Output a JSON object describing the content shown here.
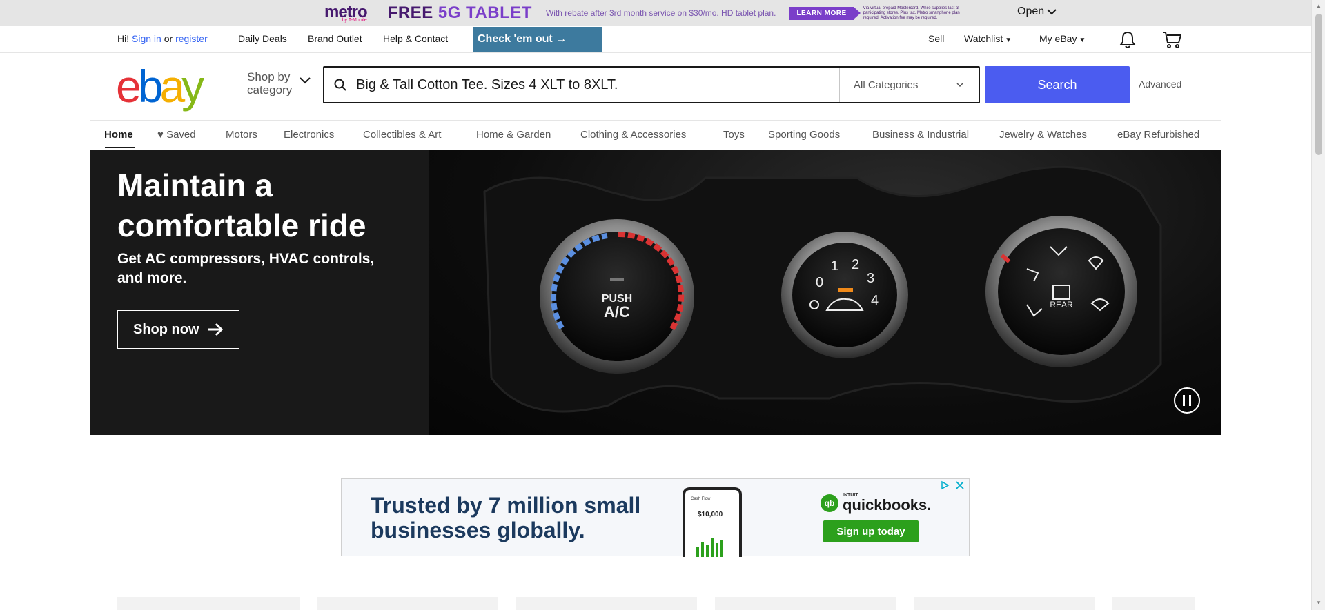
{
  "promo": {
    "brand": "metro",
    "brand_sub": "by T-Mobile",
    "headline_a": "FREE ",
    "headline_b": "5G TABLET",
    "subtext": "With rebate after 3rd month service on $30/mo. HD tablet plan.",
    "cta": "LEARN MORE",
    "fine_print": "Via virtual prepaid Mastercard. While supplies last at participating stores. Plus tax. Metro smartphone plan required. Activation fee may be required.",
    "open_label": "Open"
  },
  "topnav": {
    "greeting": "Hi!",
    "sign_in": "Sign in",
    "or": "or",
    "register": "register",
    "daily_deals": "Daily Deals",
    "brand_outlet": "Brand Outlet",
    "help": "Help & Contact",
    "check_out": "Check 'em out →",
    "sell": "Sell",
    "watchlist": "Watchlist",
    "my_ebay": "My eBay"
  },
  "header": {
    "logo": [
      "e",
      "b",
      "a",
      "y"
    ],
    "shop_by_1": "Shop by",
    "shop_by_2": "category",
    "search_value": "Big & Tall Cotton Tee. Sizes 4 XLT to 8XLT.",
    "category": "All Categories",
    "search_button": "Search",
    "advanced": "Advanced"
  },
  "catnav": {
    "items": [
      "Home",
      "Saved",
      "Motors",
      "Electronics",
      "Collectibles & Art",
      "Home & Garden",
      "Clothing & Accessories",
      "Toys",
      "Sporting Goods",
      "Business & Industrial",
      "Jewelry & Watches",
      "eBay Refurbished"
    ]
  },
  "hero": {
    "title_1": "Maintain a",
    "title_2": "comfortable ride",
    "subtitle": "Get AC compressors, HVAC controls, and more.",
    "cta": "Shop now",
    "dial1_label_1": "PUSH",
    "dial1_label_2": "A/C",
    "dial2_nums": [
      "0",
      "1",
      "2",
      "3",
      "4"
    ],
    "dial3_label": "REAR"
  },
  "ad": {
    "line1": "Trusted by 7 million small",
    "line2": "businesses globally.",
    "phone_title": "Cash Flow",
    "phone_value": "$10,000",
    "brand_small": "INTUIT",
    "brand": "quickbooks.",
    "cta": "Sign up today"
  },
  "colors": {
    "ebay_red": "#e53238",
    "ebay_blue": "#0064d2",
    "ebay_yellow": "#f5af02",
    "ebay_green": "#86b817",
    "search_button": "#4b5cf0",
    "check_btn": "#3d7a9e"
  }
}
